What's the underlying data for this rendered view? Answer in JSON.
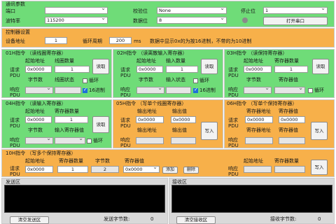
{
  "serial": {
    "title": "通讯参数",
    "port_label": "端口",
    "baud_label": "波特率",
    "baud_value": "115200",
    "parity_label": "校验位",
    "parity_value": "None",
    "databits_label": "数据位",
    "databits_value": "8",
    "stopbits_label": "停止位",
    "stopbits_value": "1",
    "open_button": "打开串口"
  },
  "control": {
    "title": "控制器设置",
    "device_addr_label": "设备地址",
    "device_addr_value": "1",
    "cycle_label": "循环周期",
    "cycle_value": "200",
    "cycle_unit": "ms",
    "note": "数据中显示0x的为按16进制，不带的为10进制"
  },
  "f01": {
    "title": "01H指令 （读线圈寄存器）",
    "start_label": "起始地址",
    "count_label": "线圈数量",
    "request_label": "请求PDU",
    "start_value": "0x0000",
    "count_value": "1",
    "bytes_label": "字节数",
    "status_label": "线圈状态",
    "response_label": "响应PDU",
    "read_button": "读取",
    "loop_label": "循环",
    "hex_label": "16进制"
  },
  "f02": {
    "title": "02H指令 （读离散输入寄存器）",
    "start_label": "起始地址",
    "count_label": "输入数量",
    "request_label": "请求PDU",
    "start_value": "0x0000",
    "count_value": "1",
    "bytes_label": "字节数",
    "status_label": "输入状态",
    "response_label": "响应PDU",
    "read_button": "读取",
    "loop_label": "循环",
    "hex_label": "16进制"
  },
  "f03": {
    "title": "03H指令 （读保持寄存器）",
    "start_label": "起始地址",
    "count_label": "寄存器数量",
    "request_label": "请求PDU",
    "start_value": "0x0000",
    "count_value": "1",
    "bytes_label": "字节数",
    "value_label": "寄存器值",
    "response_label": "响应PDU",
    "read_button": "读取",
    "loop_label": "循环"
  },
  "f04": {
    "title": "04H指令 （读输入寄存器）",
    "start_label": "起始地址",
    "count_label": "寄存器数量",
    "request_label": "请求PDU",
    "start_value": "0x0000",
    "count_value": "1",
    "bytes_label": "字节数",
    "value_label": "输入寄存器值",
    "response_label": "响应PDU",
    "read_button": "读取",
    "loop_label": "循环"
  },
  "f05": {
    "title": "05H指令 （写单个线圈寄存器）",
    "addr_label": "输出地址",
    "value_label": "输出值",
    "request_label": "请求PDU",
    "addr_value": "0x0000",
    "out_value": "0x0000",
    "addr2_label": "输出地址",
    "value2_label": "输出值",
    "response_label": "响应PDU",
    "write_button": "写入"
  },
  "f06": {
    "title": "06H指令 （写单个保持寄存器）",
    "addr_label": "寄存器地址",
    "value_label": "寄存器值",
    "request_label": "请求PDU",
    "addr_value": "0x0000",
    "reg_value": "0x0000",
    "addr2_label": "寄存器地址",
    "value2_label": "寄存器值",
    "response_label": "响应PDU",
    "write_button": "写入"
  },
  "f10": {
    "title": "10H指令 （写多个保持寄存器）",
    "start_label": "起始地址",
    "count_label": "寄存器数量",
    "bytes_label": "字节数",
    "value_label": "寄存器值",
    "request_label": "请求PDU",
    "start_value": "0x0000",
    "count_value": "1",
    "bytes_value": "2",
    "reg_value": "0x0000",
    "add_button": "添加",
    "delete_button": "删除",
    "start2_label": "起始地址",
    "count2_label": "寄存器数量",
    "response_label": "响应PDU",
    "write_button": "写入"
  },
  "send": {
    "title": "发送区",
    "clear_button": "清空发送区",
    "count_label": "发送字节数:",
    "count_value": "0"
  },
  "receive": {
    "title": "接收区",
    "clear_button": "清空接收区",
    "count_label": "接收字节数:",
    "count_value": "0"
  },
  "colors": {
    "green_panel": "#6fdc78",
    "orange_panel": "#f7b04a",
    "console_bg": "#000000",
    "checkbox_on": "#1e6fd9"
  }
}
